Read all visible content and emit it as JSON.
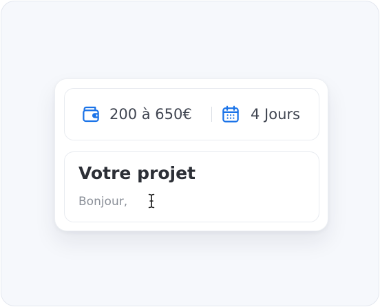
{
  "colors": {
    "accent": "#1a73e8",
    "title": "#2c2f36",
    "text": "#3f4450",
    "placeholder": "#8a8f98"
  },
  "meta": {
    "budget": {
      "icon": "wallet-icon",
      "label": "200 à 650€"
    },
    "duration": {
      "icon": "calendar-icon",
      "label": "4 Jours"
    }
  },
  "project": {
    "title": "Votre projet",
    "message": "Bonjour,",
    "cursor_icon": "text-cursor-icon"
  }
}
